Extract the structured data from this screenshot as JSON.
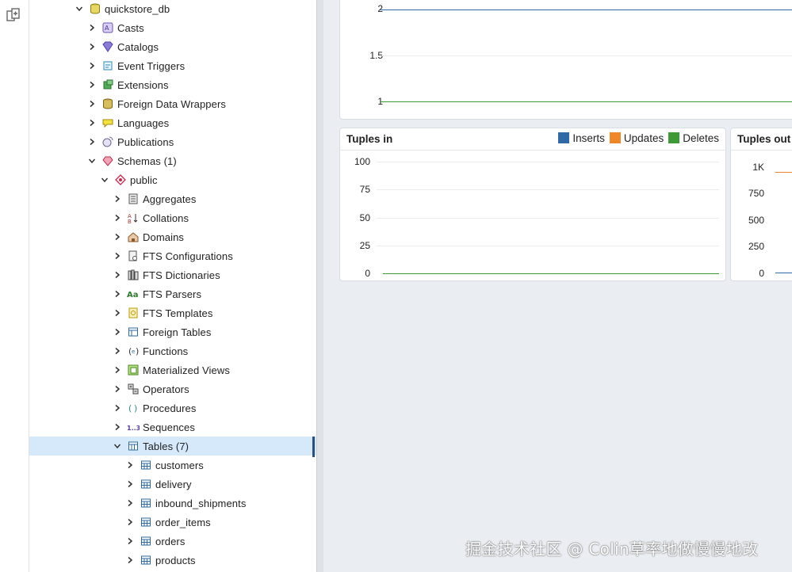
{
  "tree": {
    "items": [
      {
        "label": "quickstore_db",
        "icon": "database-icon",
        "expanded": true,
        "top": 0,
        "indent": 0
      },
      {
        "label": "Casts",
        "icon": "casts-icon",
        "expanded": false
      },
      {
        "label": "Catalogs",
        "icon": "catalogs-icon",
        "expanded": false
      },
      {
        "label": "Event Triggers",
        "icon": "event-triggers-icon",
        "expanded": false
      },
      {
        "label": "Extensions",
        "icon": "extensions-icon",
        "expanded": false
      },
      {
        "label": "Foreign Data Wrappers",
        "icon": "foreign-data-wrappers-icon",
        "expanded": false
      },
      {
        "label": "Languages",
        "icon": "languages-icon",
        "expanded": false
      },
      {
        "label": "Publications",
        "icon": "publications-icon",
        "expanded": false
      },
      {
        "label": "Schemas (1)",
        "icon": "schemas-icon",
        "expanded": true
      },
      {
        "label": "public",
        "icon": "schema-icon",
        "expanded": true
      },
      {
        "label": "Aggregates",
        "icon": "aggregates-icon",
        "expanded": false
      },
      {
        "label": "Collations",
        "icon": "collations-icon",
        "expanded": false
      },
      {
        "label": "Domains",
        "icon": "domains-icon",
        "expanded": false
      },
      {
        "label": "FTS Configurations",
        "icon": "fts-configurations-icon",
        "expanded": false
      },
      {
        "label": "FTS Dictionaries",
        "icon": "fts-dictionaries-icon",
        "expanded": false
      },
      {
        "label": "FTS Parsers",
        "icon": "fts-parsers-icon",
        "expanded": false
      },
      {
        "label": "FTS Templates",
        "icon": "fts-templates-icon",
        "expanded": false
      },
      {
        "label": "Foreign Tables",
        "icon": "foreign-tables-icon",
        "expanded": false
      },
      {
        "label": "Functions",
        "icon": "functions-icon",
        "expanded": false
      },
      {
        "label": "Materialized Views",
        "icon": "materialized-views-icon",
        "expanded": false
      },
      {
        "label": "Operators",
        "icon": "operators-icon",
        "expanded": false
      },
      {
        "label": "Procedures",
        "icon": "procedures-icon",
        "expanded": false
      },
      {
        "label": "Sequences",
        "icon": "sequences-icon",
        "expanded": false
      },
      {
        "label": "Tables (7)",
        "icon": "tables-icon",
        "expanded": true,
        "selected": true
      },
      {
        "label": "customers",
        "icon": "table-icon",
        "expanded": false
      },
      {
        "label": "delivery",
        "icon": "table-icon",
        "expanded": false
      },
      {
        "label": "inbound_shipments",
        "icon": "table-icon",
        "expanded": false
      },
      {
        "label": "order_items",
        "icon": "table-icon",
        "expanded": false
      },
      {
        "label": "orders",
        "icon": "table-icon",
        "expanded": false
      },
      {
        "label": "products",
        "icon": "table-icon",
        "expanded": false
      }
    ]
  },
  "charts": {
    "top": {
      "ticks": [
        "2",
        "1.5",
        "1"
      ],
      "line_color": "#2e7d32"
    },
    "tuples_in": {
      "title": "Tuples in",
      "legend": [
        {
          "label": "Inserts",
          "color": "#2f6aa6"
        },
        {
          "label": "Updates",
          "color": "#f0862a"
        },
        {
          "label": "Deletes",
          "color": "#3d9b35"
        }
      ],
      "ticks": [
        "100",
        "75",
        "50",
        "25",
        "0"
      ]
    },
    "tuples_out": {
      "title": "Tuples out",
      "ticks": [
        "1K",
        "750",
        "500",
        "250",
        "0"
      ]
    }
  },
  "chart_data": [
    {
      "type": "line",
      "title": "",
      "ylim": [
        1,
        2
      ],
      "yticks": [
        "2",
        "1.5",
        "1"
      ],
      "series": [
        {
          "values": [
            2,
            2
          ]
        },
        {
          "values": [
            1,
            1
          ]
        }
      ]
    },
    {
      "type": "line",
      "title": "Tuples in",
      "ylim": [
        0,
        100
      ],
      "yticks": [
        "100",
        "75",
        "50",
        "25",
        "0"
      ],
      "legend": "top-right",
      "series": [
        {
          "name": "Inserts",
          "values": [
            0,
            0
          ]
        },
        {
          "name": "Updates",
          "values": [
            0,
            0
          ]
        },
        {
          "name": "Deletes",
          "values": [
            0,
            0
          ]
        }
      ]
    },
    {
      "type": "line",
      "title": "Tuples out",
      "ylim": [
        0,
        1000
      ],
      "yticks": [
        "1K",
        "750",
        "500",
        "250",
        "0"
      ],
      "series": [
        {
          "values": [
            1000,
            1000
          ]
        },
        {
          "values": [
            0,
            0
          ]
        }
      ]
    }
  ],
  "watermark": "掘金技术社区 @ Colin草率地做慢慢地改"
}
